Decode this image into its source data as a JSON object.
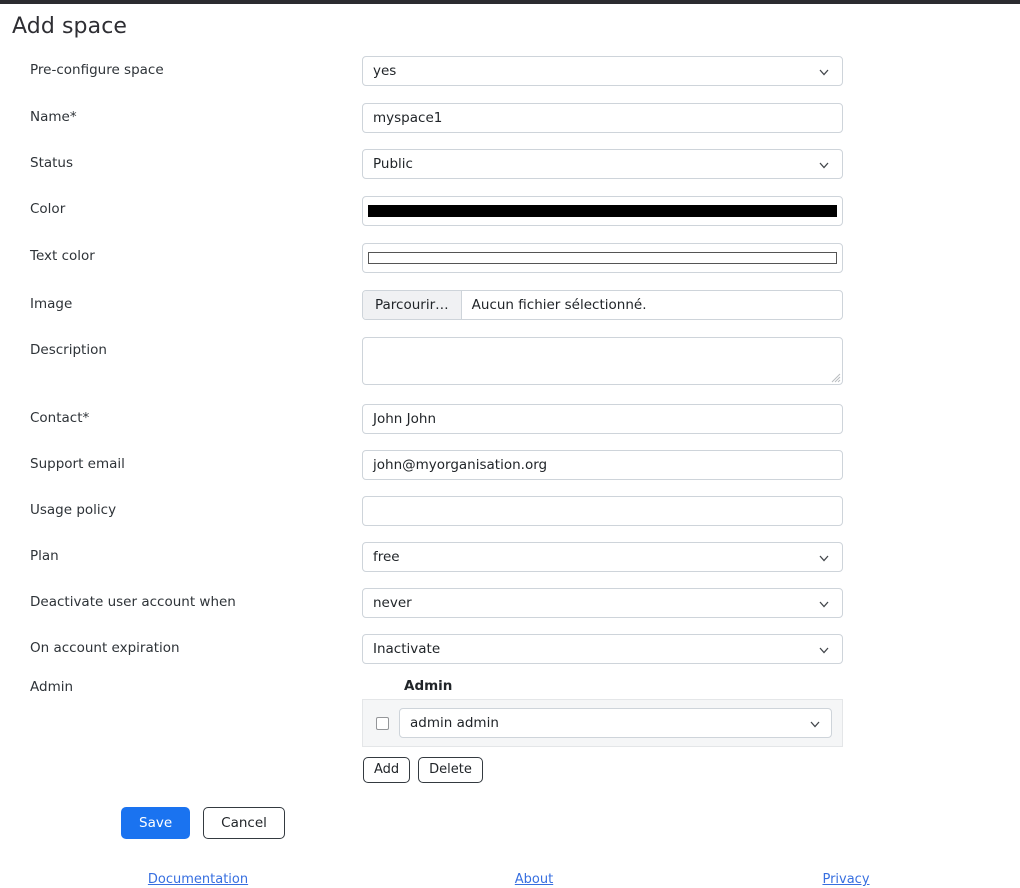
{
  "page": {
    "title": "Add space"
  },
  "fields": {
    "preconfigure": {
      "label": "Pre-configure space",
      "value": "yes",
      "type": "select"
    },
    "name": {
      "label": "Name*",
      "value": "myspace1",
      "type": "text"
    },
    "status": {
      "label": "Status",
      "value": "Public",
      "type": "select"
    },
    "color": {
      "label": "Color",
      "value": "#000000",
      "type": "color"
    },
    "text_color": {
      "label": "Text color",
      "value": "#ffffff",
      "type": "color"
    },
    "image": {
      "label": "Image",
      "browse_label": "Parcourir…",
      "file_status": "Aucun fichier sélectionné.",
      "type": "file"
    },
    "description": {
      "label": "Description",
      "value": "",
      "type": "textarea"
    },
    "contact": {
      "label": "Contact*",
      "value": "John John",
      "type": "text"
    },
    "support_email": {
      "label": "Support email",
      "value": "john@myorganisation.org",
      "type": "text"
    },
    "usage_policy": {
      "label": "Usage policy",
      "value": "",
      "type": "text"
    },
    "plan": {
      "label": "Plan",
      "value": "free",
      "type": "select"
    },
    "deactivate_when": {
      "label": "Deactivate user account when",
      "value": "never",
      "type": "select"
    },
    "on_expiration": {
      "label": "On account expiration",
      "value": "Inactivate",
      "type": "select"
    },
    "admin": {
      "label": "Admin",
      "column_header": "Admin",
      "rows": [
        {
          "selected": false,
          "value": "admin admin"
        }
      ],
      "add_label": "Add",
      "delete_label": "Delete"
    }
  },
  "actions": {
    "save_label": "Save",
    "cancel_label": "Cancel"
  },
  "footer": {
    "documentation": "Documentation",
    "about": "About",
    "privacy": "Privacy"
  },
  "colors": {
    "accent": "#1a73f0",
    "link": "#376fe0",
    "topbar": "#2b2b30",
    "border": "#ced4da"
  }
}
